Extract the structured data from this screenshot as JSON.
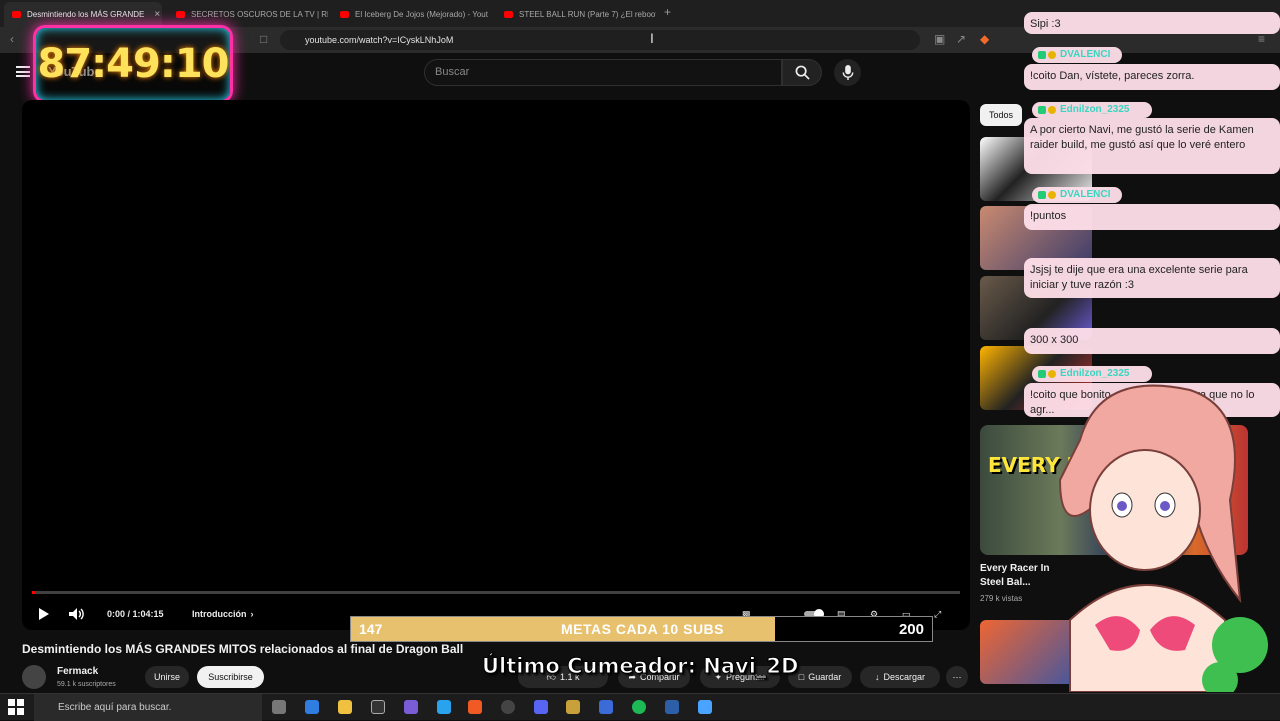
{
  "browser": {
    "tabs": [
      {
        "title": "Desmintiendo los MÁS GRANDE",
        "active": true
      },
      {
        "title": "SECRETOS OSCUROS DE LA TV | REC",
        "active": false
      },
      {
        "title": "El Iceberg De Jojos (Mejorado) - Yout",
        "active": false
      },
      {
        "title": "STEEL BALL RUN (Parte 7) ¿El reboot",
        "active": false
      }
    ],
    "close_glyph": "×",
    "new_tab_glyph": "+",
    "url": "youtube.com/watch?v=ICyskLNhJoM"
  },
  "overlay": {
    "timer": "87:49:10",
    "goal_start": "147",
    "goal_label": "METAS CADA 10 SUBS",
    "goal_end": "200",
    "goal_progress_fraction": 0.729,
    "last_cum": "Último Cumeador: Navi_2D"
  },
  "youtube": {
    "logo": "YouTube",
    "search_placeholder": "Buscar",
    "player": {
      "time": "0:00 / 1:04:15",
      "chapter": "Introducción",
      "progress_fraction": 0.003
    },
    "video_title": "Desmintiendo los MÁS GRANDES MITOS relacionados al final de Dragon Ball",
    "channel": {
      "name": "Fermack",
      "subs": "59.1 k suscriptores"
    },
    "join_label": "Unirse",
    "subscribe_label": "Suscribirse",
    "like_count": "1.1 k",
    "share_label": "Compartir",
    "ask_label": "Preguntar",
    "save_label": "Guardar",
    "download_label": "Descargar",
    "chip_all": "Todos",
    "rec_title": "Every Racer In Steel Bal...",
    "rec_views": "279 k vistas",
    "big_thumb_text": "EVERY RACER"
  },
  "chat": [
    {
      "user": "",
      "text": "Sipi :3"
    },
    {
      "user": "DVALENCI",
      "text": "!coito Dan, vístete, pareces zorra."
    },
    {
      "user": "Ednilzon_2325",
      "text": "A por cierto Navi, me gustó la serie de Kamen raider build, me gustó así que lo veré entero"
    },
    {
      "user": "DVALENCI",
      "text": "!puntos"
    },
    {
      "user": "",
      "text": "Jsjsj te dije que era una excelente serie para iniciar y tuve razón :3"
    },
    {
      "user": "",
      "text": "300 x 300"
    },
    {
      "user": "Ednilzon_2325",
      "text": "!coito que bonito, ahora cuánto para que no lo agr..."
    }
  ],
  "taskbar": {
    "search_placeholder": "Escribe aquí para buscar."
  },
  "colors": {
    "youtube_red": "#ff0000",
    "chat_bubble": "#fddee8",
    "goal_fill": "#e8c16e",
    "timer_glow": "#ff2fa8"
  }
}
